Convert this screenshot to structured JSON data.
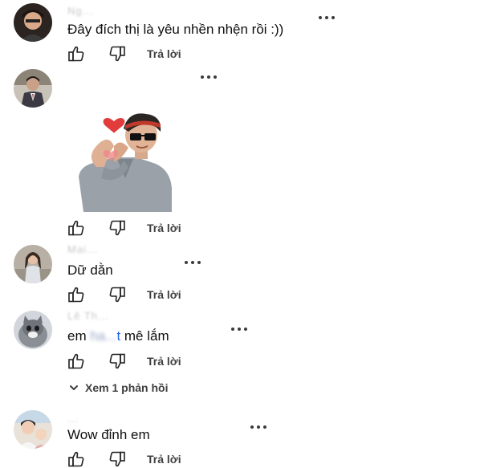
{
  "comments": [
    {
      "author_hint": "Ng...",
      "text": "Đây đích thị là yêu nhền nhện rồi :))",
      "reply_label": "Trả lời"
    },
    {
      "author_hint": "",
      "text": "",
      "has_sticker": true,
      "reply_label": "Trả lời"
    },
    {
      "author_hint": "Mai...",
      "text": "Dữ dằn",
      "reply_label": "Trả lời"
    },
    {
      "author_hint": "Lê Th...",
      "text_prefix": "em ",
      "text_blurred": "ha...",
      "text_blue": "t",
      "text_suffix": " mê lắm",
      "reply_label": "Trả lời"
    },
    {
      "author_hint": "...",
      "text": "Wow đỉnh em",
      "reply_label": "Trả lời"
    }
  ],
  "replies_toggle": {
    "label": "Xem 1 phản hồi"
  },
  "colors": {
    "text": "#0f0f0f",
    "muted": "#3f3f3f",
    "link": "#2563eb",
    "background": "#ffffff"
  },
  "icons": [
    "thumbs-up-icon",
    "thumbs-down-icon",
    "more-vert-icon",
    "chevron-down-icon"
  ]
}
